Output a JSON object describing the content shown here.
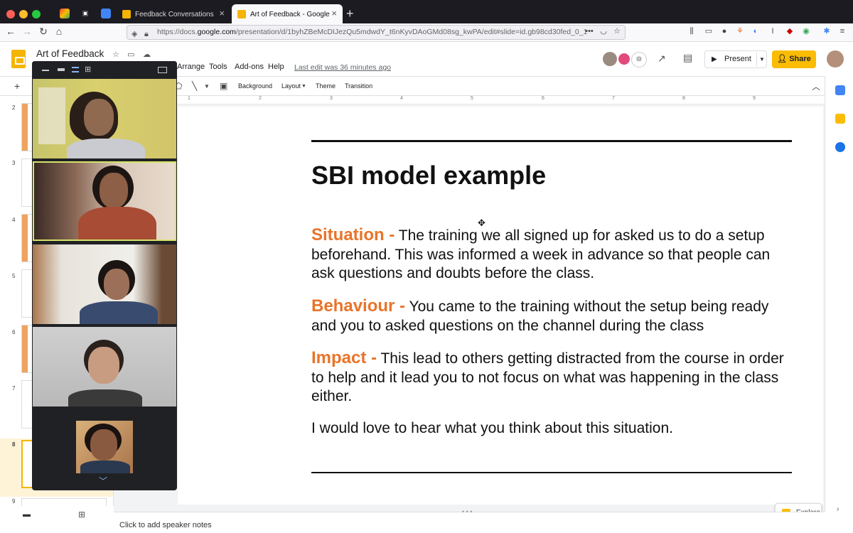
{
  "browser": {
    "tabs": [
      {
        "title": "Feedback Conversations",
        "active": false
      },
      {
        "title": "Art of Feedback - Google Slides",
        "active": true
      }
    ],
    "new_tab": "+",
    "url_prefix": "https://docs.",
    "url_domain": "google.com",
    "url_path": "/presentation/d/1byhZBeMcDIJezQu5mdwdY_t6nKyvDAoGMd08sg_kwPA/edit#slide=id.gb98cd30fed_0_1",
    "url_menu": "•••"
  },
  "doc": {
    "title": "Art of Feedback",
    "menus": [
      "Arrange",
      "Tools",
      "Add-ons",
      "Help"
    ],
    "last_edit": "Last edit was 36 minutes ago",
    "present_label": "Present",
    "share_label": "Share"
  },
  "toolbar": {
    "items": [
      "Background",
      "Layout",
      "Theme",
      "Transition"
    ]
  },
  "ruler": {
    "numbers": [
      "1",
      "2",
      "3",
      "4",
      "5",
      "6",
      "7",
      "8",
      "9"
    ]
  },
  "filmstrip": {
    "slide_numbers": [
      "2",
      "3",
      "4",
      "5",
      "6",
      "7",
      "8",
      "9"
    ],
    "selected": "8"
  },
  "slide": {
    "title": "SBI model example",
    "situation_label": "Situation -",
    "situation_text": " The training we all signed up for asked us to do a setup beforehand. This was informed a week in advance so that people can ask questions and doubts before the class.",
    "behaviour_label": "Behaviour -",
    "behaviour_text": "  You came to the training without the setup being ready and you to asked questions on the channel during the class",
    "impact_label": "Impact -",
    "impact_text": " This lead to others getting distracted from the course in order to help and it lead you to not focus on what was happening in the class either.",
    "closing": "I would love to hear what you think about this situation."
  },
  "notes": {
    "placeholder": "Click to add speaker notes"
  },
  "explore": {
    "label": "Explore"
  },
  "meet": {
    "participant_count": 5,
    "self_view": true
  },
  "colors": {
    "accent_orange": "#e8742a",
    "share_yellow": "#fbbc04",
    "tab_bar": "#1c1b22"
  }
}
